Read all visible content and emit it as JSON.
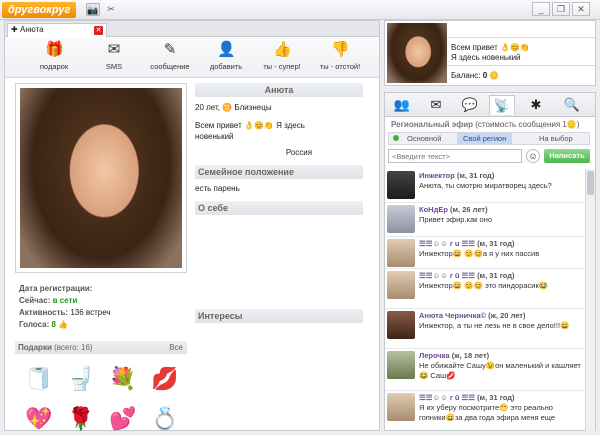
{
  "app": {
    "logo_text": "другвокруг"
  },
  "window": {
    "minimize": "_",
    "restore": "❐",
    "close": "✕"
  },
  "left_tab": {
    "label": "Анюта",
    "close": "✕"
  },
  "toolbar": [
    {
      "label": "подарок",
      "icon": "gift-icon",
      "glyph": "🎁"
    },
    {
      "label": "SMS",
      "icon": "sms-envelope-icon",
      "glyph": "✉"
    },
    {
      "label": "сообщение",
      "icon": "message-icon",
      "glyph": "✎"
    },
    {
      "label": "добавить",
      "icon": "add-user-icon",
      "glyph": "👤"
    },
    {
      "label": "ты - супер!",
      "icon": "thumbs-up-icon",
      "glyph": "👍"
    },
    {
      "label": "ты - отстой!",
      "icon": "thumbs-down-icon",
      "glyph": "👎"
    }
  ],
  "profile": {
    "name": "Анюта",
    "age_sign": "20 лет,",
    "zodiac": "Близнецы",
    "status_line1": "Всем привет",
    "status_line2": "Я здесь",
    "status_line3": "новенький",
    "city": "Россия",
    "family_header": "Семейное положение",
    "family_value": "есть парень",
    "about_header": "О себе",
    "interests_header": "Интересы"
  },
  "stats": {
    "reg_label": "Дата регистрации:",
    "now_label": "Сейчас:",
    "now_value": "в сети",
    "activity_label": "Активность:",
    "activity_value": "136 встреч",
    "votes_label": "Голоса:",
    "votes_value": "8"
  },
  "gifts": {
    "header": "Подарки",
    "count": "(всего: 16)",
    "all_link": "Все",
    "items": [
      "🧻",
      "🚽",
      "💐",
      "💋",
      "💖",
      "🌹",
      "💕",
      "💍"
    ]
  },
  "mini_card": {
    "status": "Всем привет",
    "status2": "Я здесь новенький",
    "balance_label": "Баланс:",
    "balance_value": "0"
  },
  "chat": {
    "title": "Региональный эфир",
    "cost": "(стоимость сообщения 1",
    "tabs": [
      "Основной",
      "Свой регион",
      "На выбор"
    ],
    "input_placeholder": "<Введите текст>",
    "send_label": "Написать",
    "messages": [
      {
        "nick": "Инжектор",
        "meta": "(м, 31 год)",
        "text": "Анюта, ты смотрю миратворец здесь?",
        "color": "#2b2b2b"
      },
      {
        "nick": "КоНдЕр",
        "meta": "(м, 26 лет)",
        "text": "Привет эфир.как оно",
        "color": "#a9a9b4"
      },
      {
        "nick": "☰☰☺☺ r u ☰☰",
        "meta": "(м, 31 год)",
        "text": "Инжектор😄 😊😊а я у них пассив",
        "color": "#c8b49a"
      },
      {
        "nick": "☰☰☺☺ r ū ☰☰",
        "meta": "(м, 31 год)",
        "text": "Инжектор😄 😊😊 это пиндорасик😂",
        "color": "#c8b49a"
      },
      {
        "nick": "Анюта Черничка©",
        "meta": "(ж, 20 лет)",
        "text": "Инжектор, а ты не лезь не в свое дело!!!😄",
        "color": "#6a4a3a"
      },
      {
        "nick": "Лерочка",
        "meta": "(ж, 18 лет)",
        "text": "Не обижайте Сашу😉он маленький и кашляет😂 Саш💋",
        "color": "#7a8a60"
      },
      {
        "nick": "☰☰☺☺ r ū ☰☰",
        "meta": "(м, 31 год)",
        "text": "Я их уберу посмотрите😁 это реально гопники😄за два года эфира меня еще",
        "color": "#c8b49a"
      }
    ]
  }
}
